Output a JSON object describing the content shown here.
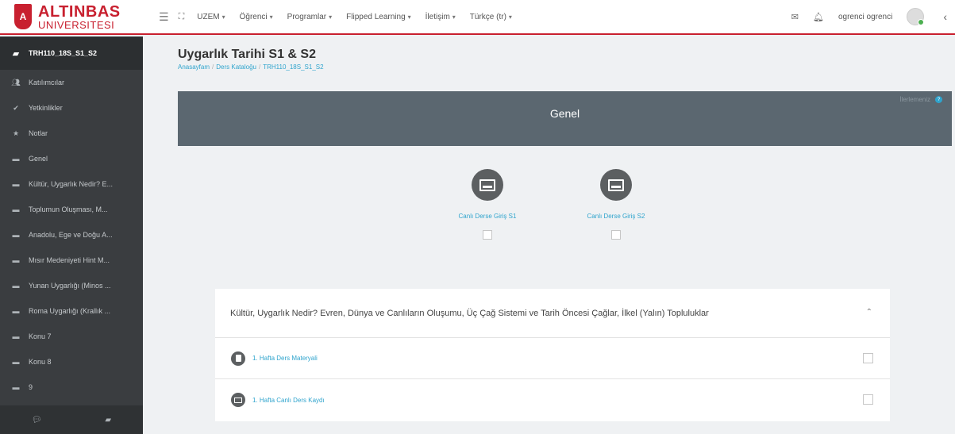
{
  "brand": {
    "logo_letter": "A",
    "name_main": "ALTINBAS",
    "name_sub": "UNIVERSITESI",
    "color": "#c8202f"
  },
  "nav": {
    "menu_icon": "hamburger-icon",
    "fullscreen_icon": "fullscreen-icon",
    "items": [
      {
        "label": "UZEM"
      },
      {
        "label": "Öğrenci"
      },
      {
        "label": "Programlar"
      },
      {
        "label": "Flipped Learning"
      },
      {
        "label": "İletişim"
      },
      {
        "label": "Türkçe (tr)"
      }
    ],
    "user_name": "ogrenci ogrenci"
  },
  "sidebar": {
    "items": [
      {
        "label": "TRH110_18S_S1_S2",
        "icon": "course-icon"
      },
      {
        "label": "Katılımcılar",
        "icon": "users-icon"
      },
      {
        "label": "Yetkinlikler",
        "icon": "check-circle-icon"
      },
      {
        "label": "Notlar",
        "icon": "star-icon"
      },
      {
        "label": "Genel",
        "icon": "folder-icon"
      },
      {
        "label": "Kültür, Uygarlık Nedir? E...",
        "icon": "folder-icon"
      },
      {
        "label": "Toplumun Oluşması, M...",
        "icon": "folder-icon"
      },
      {
        "label": "Anadolu, Ege ve Doğu A...",
        "icon": "folder-icon"
      },
      {
        "label": "Mısır Medeniyeti Hint M...",
        "icon": "folder-icon"
      },
      {
        "label": "Yunan Uygarlığı (Minos ...",
        "icon": "folder-icon"
      },
      {
        "label": "Roma Uygarlığı (Krallık ...",
        "icon": "folder-icon"
      },
      {
        "label": "Konu 7",
        "icon": "folder-icon"
      },
      {
        "label": "Konu 8",
        "icon": "folder-icon"
      },
      {
        "label": "9",
        "icon": "folder-icon"
      }
    ]
  },
  "page": {
    "title": "Uygarlık Tarihi S1 & S2",
    "breadcrumb": [
      "Anasayfam",
      "Ders Kataloğu",
      "TRH110_18S_S1_S2"
    ]
  },
  "general": {
    "title": "Genel",
    "progress_label": "İlerlemeniz",
    "activities": [
      {
        "label": "Canlı Derse Giriş S1"
      },
      {
        "label": "Canlı Derse Giriş S2"
      }
    ]
  },
  "section": {
    "title": "Kültür, Uygarlık Nedir? Evren, Dünya ve Canlıların Oluşumu, Üç Çağ Sistemi ve Tarih Öncesi Çağlar, İlkel (Yalın) Topluluklar",
    "activities": [
      {
        "label": "1. Hafta Ders Materyali",
        "icon": "document-icon"
      },
      {
        "label": "1. Hafta Canlı Ders Kaydı",
        "icon": "video-recording-icon"
      }
    ]
  },
  "colors": {
    "accent": "#2fa4cd",
    "sidebar_bg": "#3a3d40",
    "section_header_bg": "#5b6770"
  }
}
